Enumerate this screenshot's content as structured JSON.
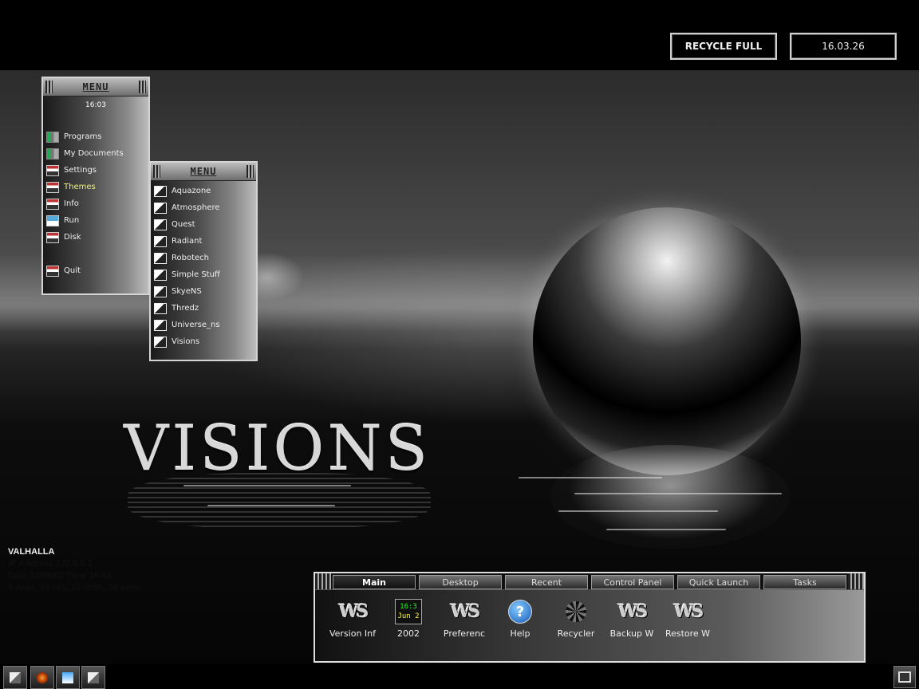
{
  "top": {
    "recycle_label": "RECYCLE FULL",
    "date": "16.03.26"
  },
  "wallpaper": {
    "title": "VISIONS"
  },
  "main_menu": {
    "title": "MENU",
    "time": "16:03",
    "items": [
      {
        "label": "Programs",
        "icon": "chart-icon"
      },
      {
        "label": "My Documents",
        "icon": "chart-icon"
      },
      {
        "label": "Settings",
        "icon": "folder-icon"
      },
      {
        "label": "Themes",
        "icon": "folder-icon",
        "active": true
      },
      {
        "label": "Info",
        "icon": "folder-icon"
      },
      {
        "label": "Run",
        "icon": "run-icon"
      },
      {
        "label": "Disk",
        "icon": "folder-icon"
      },
      {
        "label": "Quit",
        "icon": "folder-icon"
      }
    ]
  },
  "themes_menu": {
    "title": "MENU",
    "items": [
      "Aquazone",
      "Atmosphere",
      "Quest",
      "Radiant",
      "Robotech",
      "Simple Stuff",
      "SkyeNS",
      "Thredz",
      "Universe_ns",
      "Visions"
    ]
  },
  "sysinfo": {
    "hostname": "VALHALLA",
    "lines": [
      "IP Address 127.0.0.1",
      "Date 02/06/02 Time 16:03",
      "0 days, 00 hrs, 10 mins, 03 secs"
    ]
  },
  "launcher": {
    "tabs": [
      "Main",
      "Desktop",
      "Recent",
      "Control Panel",
      "Quick Launch",
      "Tasks"
    ],
    "active_tab": "Main",
    "items": [
      {
        "label": "Version Inf",
        "icon": "ws-icon"
      },
      {
        "label": "2002",
        "icon": "clock-icon",
        "clock_time": "16:3",
        "clock_date": "Jun 2"
      },
      {
        "label": "Preferenc",
        "icon": "ws-icon"
      },
      {
        "label": "Help",
        "icon": "help-icon"
      },
      {
        "label": "Recycler",
        "icon": "recycler-icon"
      },
      {
        "label": "Backup W",
        "icon": "ws-icon"
      },
      {
        "label": "Restore W",
        "icon": "ws-icon"
      }
    ]
  }
}
